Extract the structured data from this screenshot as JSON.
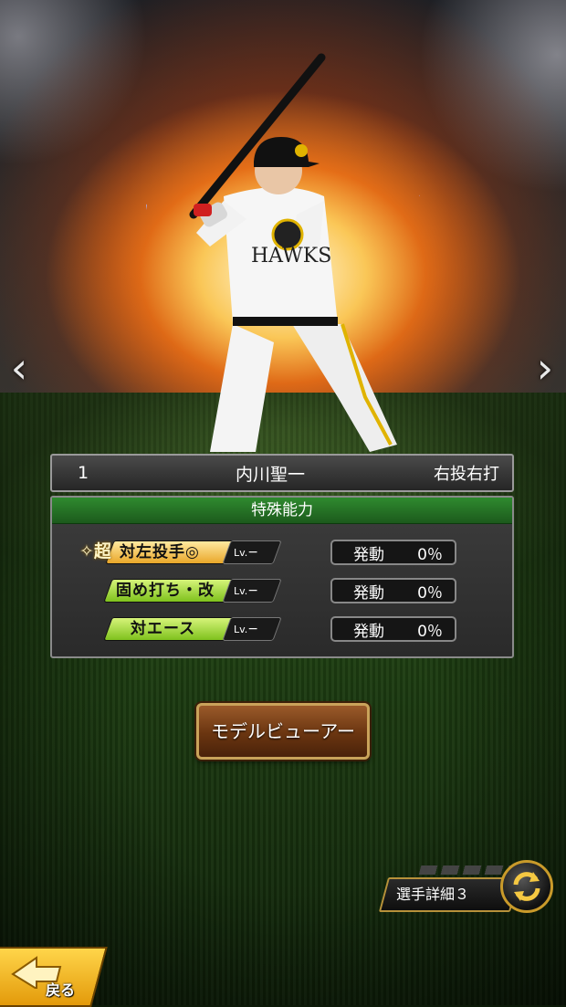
{
  "nav": {
    "prev_glyph": "‹",
    "next_glyph": "›"
  },
  "player": {
    "number": "1",
    "name": "内川聖一",
    "handedness": "右投右打",
    "jersey_text": "HAWKS"
  },
  "special_abilities": {
    "header": "特殊能力",
    "items": [
      {
        "prefix": "超",
        "name": "対左投手◎",
        "level_label": "Lv.",
        "level_value": "−",
        "status_label": "発動",
        "status_value": "0％",
        "tag_color": "gold"
      },
      {
        "prefix": "",
        "name": "固め打ち・改",
        "level_label": "Lv.",
        "level_value": "−",
        "status_label": "発動",
        "status_value": "0％",
        "tag_color": "green"
      },
      {
        "prefix": "",
        "name": "対エース",
        "level_label": "Lv.",
        "level_value": "−",
        "status_label": "発動",
        "status_value": "0％",
        "tag_color": "green"
      }
    ]
  },
  "model_viewer_label": "モデルビューアー",
  "detail_switch": {
    "label": "選手詳細３",
    "icon": "cycle-arrows-icon"
  },
  "back_button": {
    "label": "戻る",
    "icon": "back-arrow-icon"
  },
  "colors": {
    "panel_header": "#1c5a1c",
    "gold_tag": "#e9a72a",
    "green_tag": "#7fc21d",
    "button_brown": "#6a3510",
    "back_yellow": "#ffd54a"
  }
}
